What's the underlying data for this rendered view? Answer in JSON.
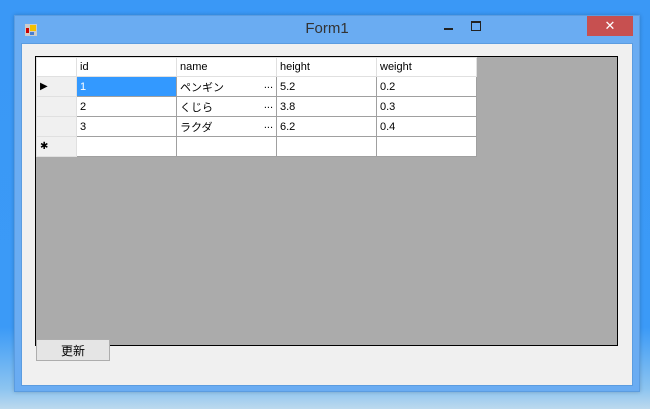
{
  "window": {
    "title": "Form1",
    "close": "✕"
  },
  "grid": {
    "columns": [
      "id",
      "name",
      "height",
      "weight"
    ],
    "rows": [
      [
        "1",
        "ペンギン",
        "5.2",
        "0.2"
      ],
      [
        "2",
        "くじら",
        "3.8",
        "0.3"
      ],
      [
        "3",
        "ラクダ",
        "6.2",
        "0.4"
      ]
    ],
    "current_row_marker": "▶",
    "new_row_marker": "✱",
    "ellipsis": "..."
  },
  "button": {
    "label": "更新"
  }
}
